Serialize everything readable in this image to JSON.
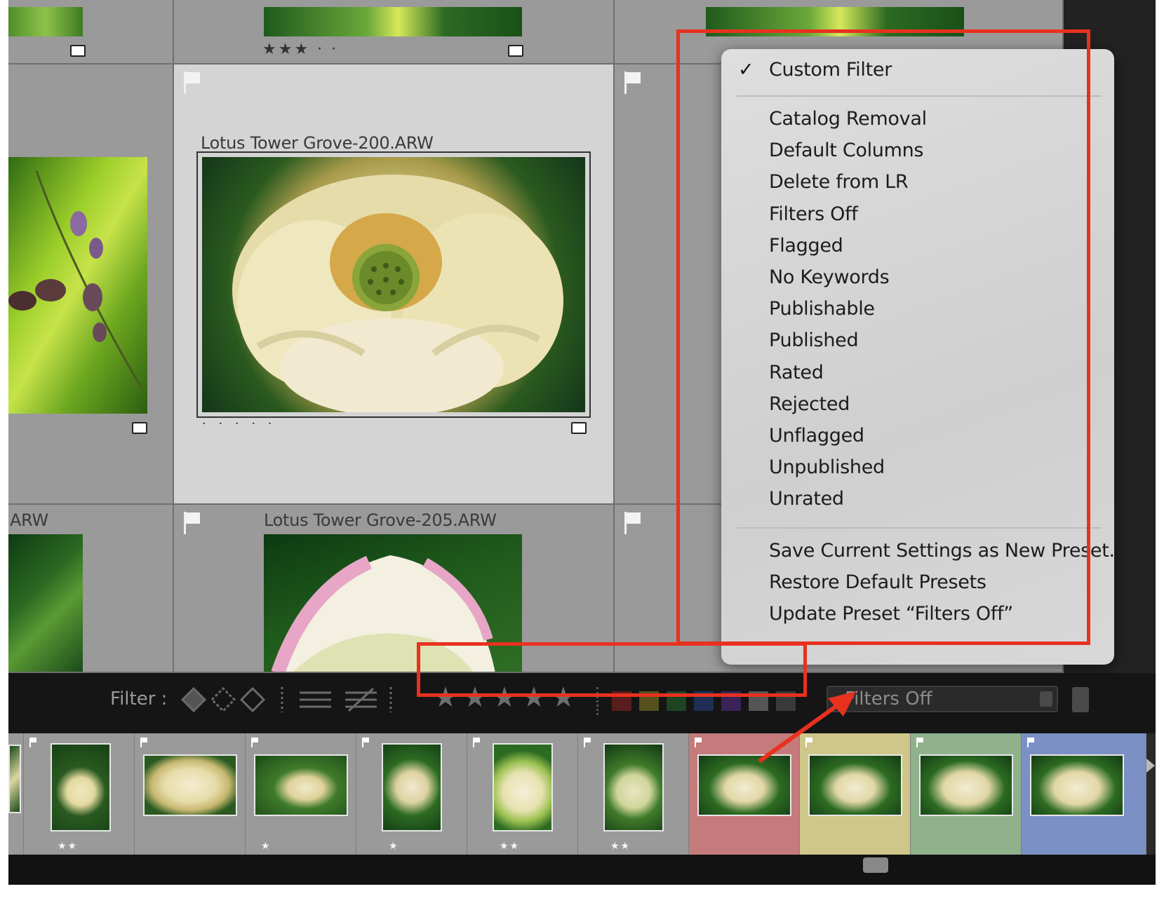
{
  "grid": {
    "cells": [
      {
        "caption": "",
        "stars": ""
      },
      {
        "caption": "",
        "stars": "★★★ · ·"
      },
      {
        "caption": "Lotus Tower Grove-200.ARW",
        "stars": "· · · · ·"
      },
      {
        "caption": "ARW",
        "stars": ""
      },
      {
        "caption": "Lotus Tower Grove-205.ARW",
        "stars": ""
      }
    ]
  },
  "menu": {
    "checked_item": "Custom Filter",
    "check_mark": "✓",
    "presets": [
      "Catalog Removal",
      "Default Columns",
      "Delete from LR",
      "Filters Off",
      "Flagged",
      "No Keywords",
      "Publishable",
      "Published",
      "Rated",
      "Rejected",
      "Unflagged",
      "Unpublished",
      "Unrated"
    ],
    "actions": [
      "Save Current Settings as New Preset...",
      "Restore Default Presets",
      "Update Preset “Filters Off”"
    ]
  },
  "filter_bar": {
    "label": "Filter :",
    "rating_stars": [
      "★",
      "★",
      "★",
      "★",
      "★"
    ],
    "color_labels": [
      "#5a1d1d",
      "#55501c",
      "#1e4423",
      "#1d2f55",
      "#3b2357",
      "#555555",
      "#3a3a3a"
    ],
    "preset_value": "Filters Off"
  },
  "filmstrip": {
    "thumbs": [
      {
        "stars": "",
        "bg": "#9a9a9a"
      },
      {
        "stars": "★★",
        "bg": "#9a9a9a"
      },
      {
        "stars": "",
        "bg": "#9a9a9a"
      },
      {
        "stars": "★",
        "bg": "#9a9a9a"
      },
      {
        "stars": "★",
        "bg": "#9a9a9a"
      },
      {
        "stars": "★★",
        "bg": "#9a9a9a"
      },
      {
        "stars": "★★",
        "bg": "#9a9a9a"
      },
      {
        "stars": "",
        "bg": "#c57b7b"
      },
      {
        "stars": "",
        "bg": "#cfc78a"
      },
      {
        "stars": "",
        "bg": "#8fb28d"
      },
      {
        "stars": "",
        "bg": "#7b90c5"
      }
    ]
  },
  "colors": {
    "highlight": "#e8311f",
    "cell_bg": "#9a9a9a",
    "selected_cell_bg": "#d4d4d4"
  }
}
